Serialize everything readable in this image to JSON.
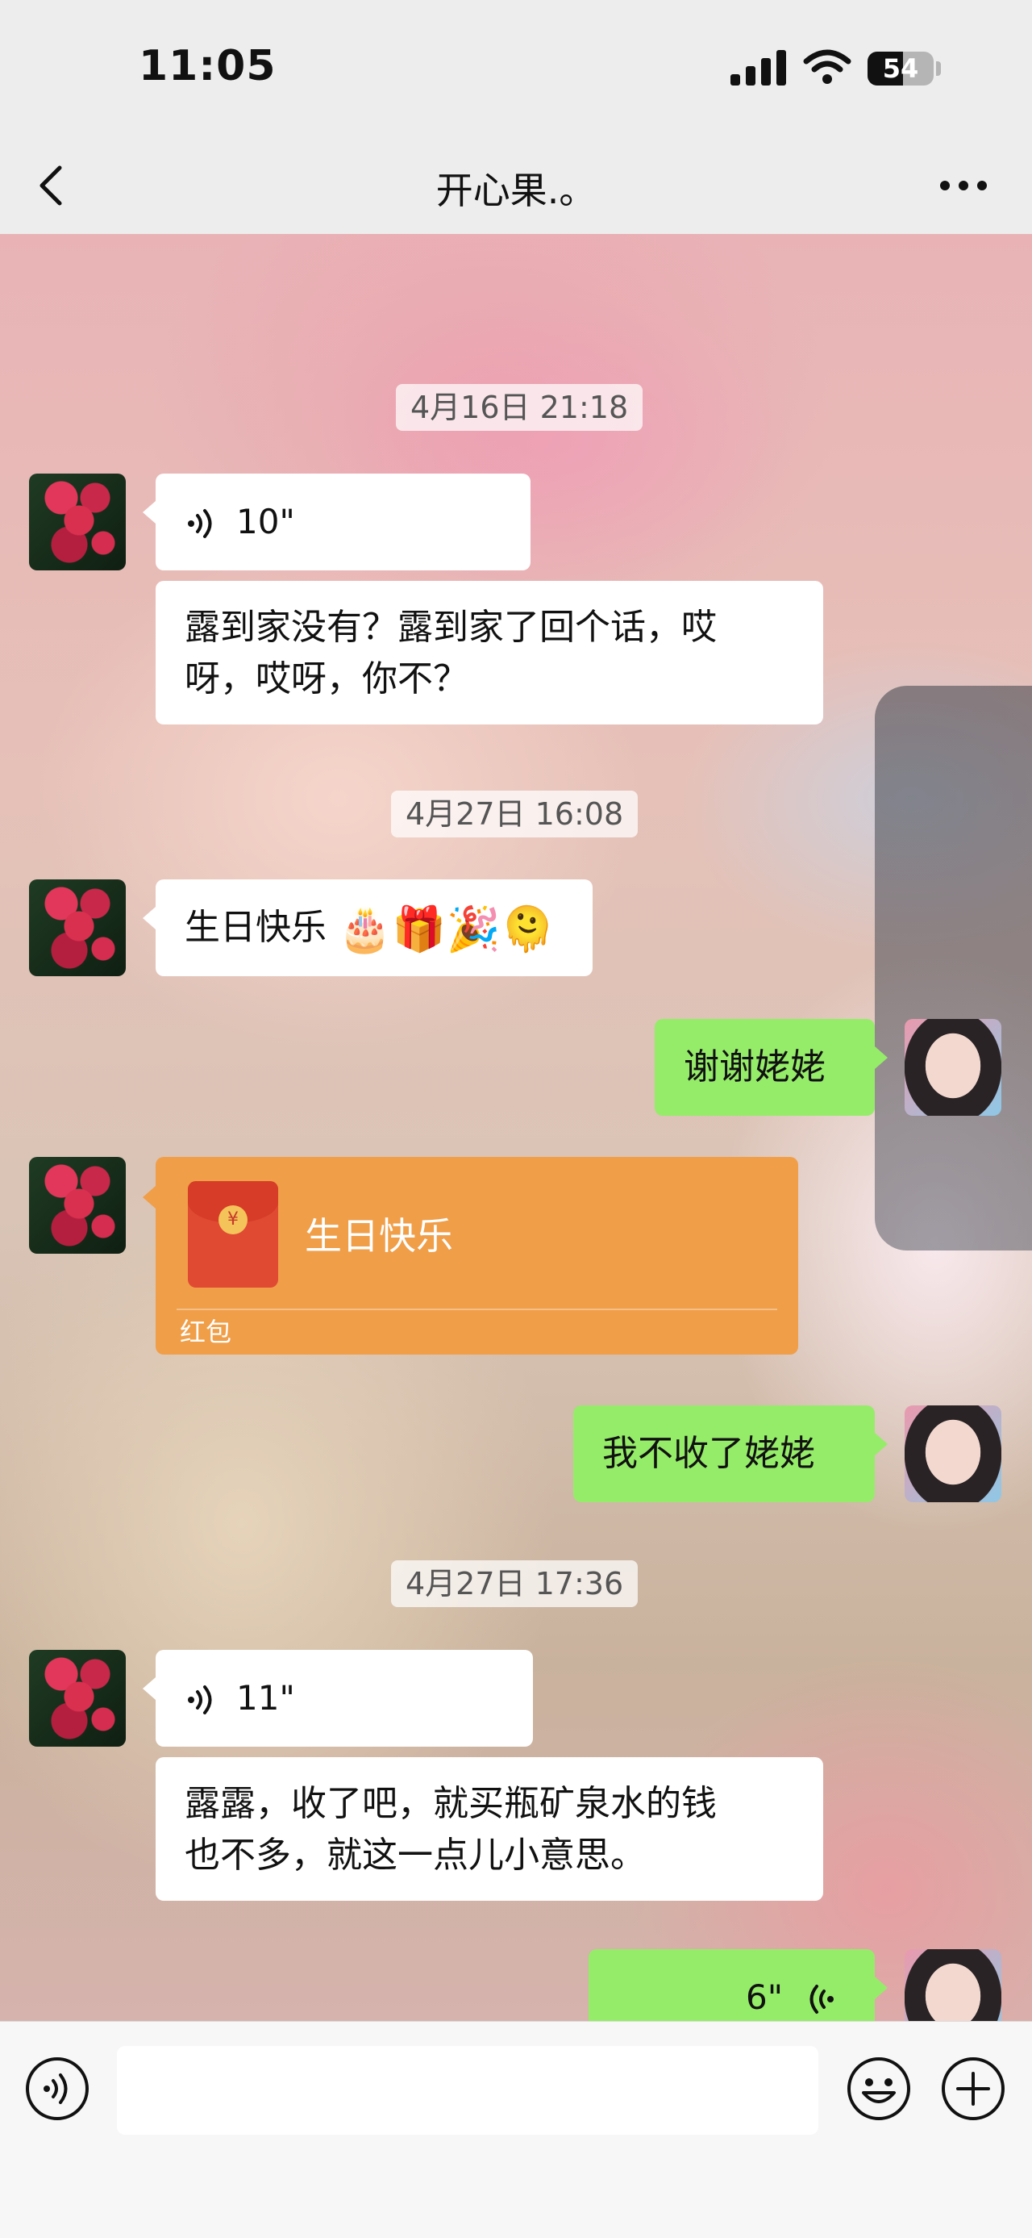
{
  "status_bar": {
    "time": "11:05",
    "battery": "54",
    "battery_level": 0.54
  },
  "nav": {
    "title": "开心果.。"
  },
  "messages": {
    "ts1": "4月16日 21:18",
    "voice1": "10\"",
    "text1_line1": "露到家没有？露到家了回个话，哎",
    "text1_line2": "呀，哎呀，你不？",
    "ts2": "4月27日 16:08",
    "text2": "生日快乐",
    "text2_emoji": "🎂🎁🎉🫠",
    "reply1": "谢谢姥姥",
    "red_packet_title": "生日快乐",
    "red_packet_label": "红包",
    "reply2": "我不收了姥姥",
    "ts3": "4月27日 17:36",
    "voice2": "11\"",
    "text3_line1": "露露，收了吧，就买瓶矿泉水的钱",
    "text3_line2": "也不多，就这一点儿小意思。",
    "voice3": "6\""
  },
  "input": {
    "value": "",
    "placeholder": ""
  },
  "colors": {
    "outgoing_bubble": "#95ec69",
    "incoming_bubble": "#ffffff",
    "red_packet": "#f09e48",
    "bar_background": "#ededed"
  },
  "icons": [
    "back-chevron-icon",
    "more-dots-icon",
    "voice-wave-icon",
    "voice-mode-icon",
    "emoji-icon",
    "plus-icon",
    "red-packet-icon"
  ]
}
